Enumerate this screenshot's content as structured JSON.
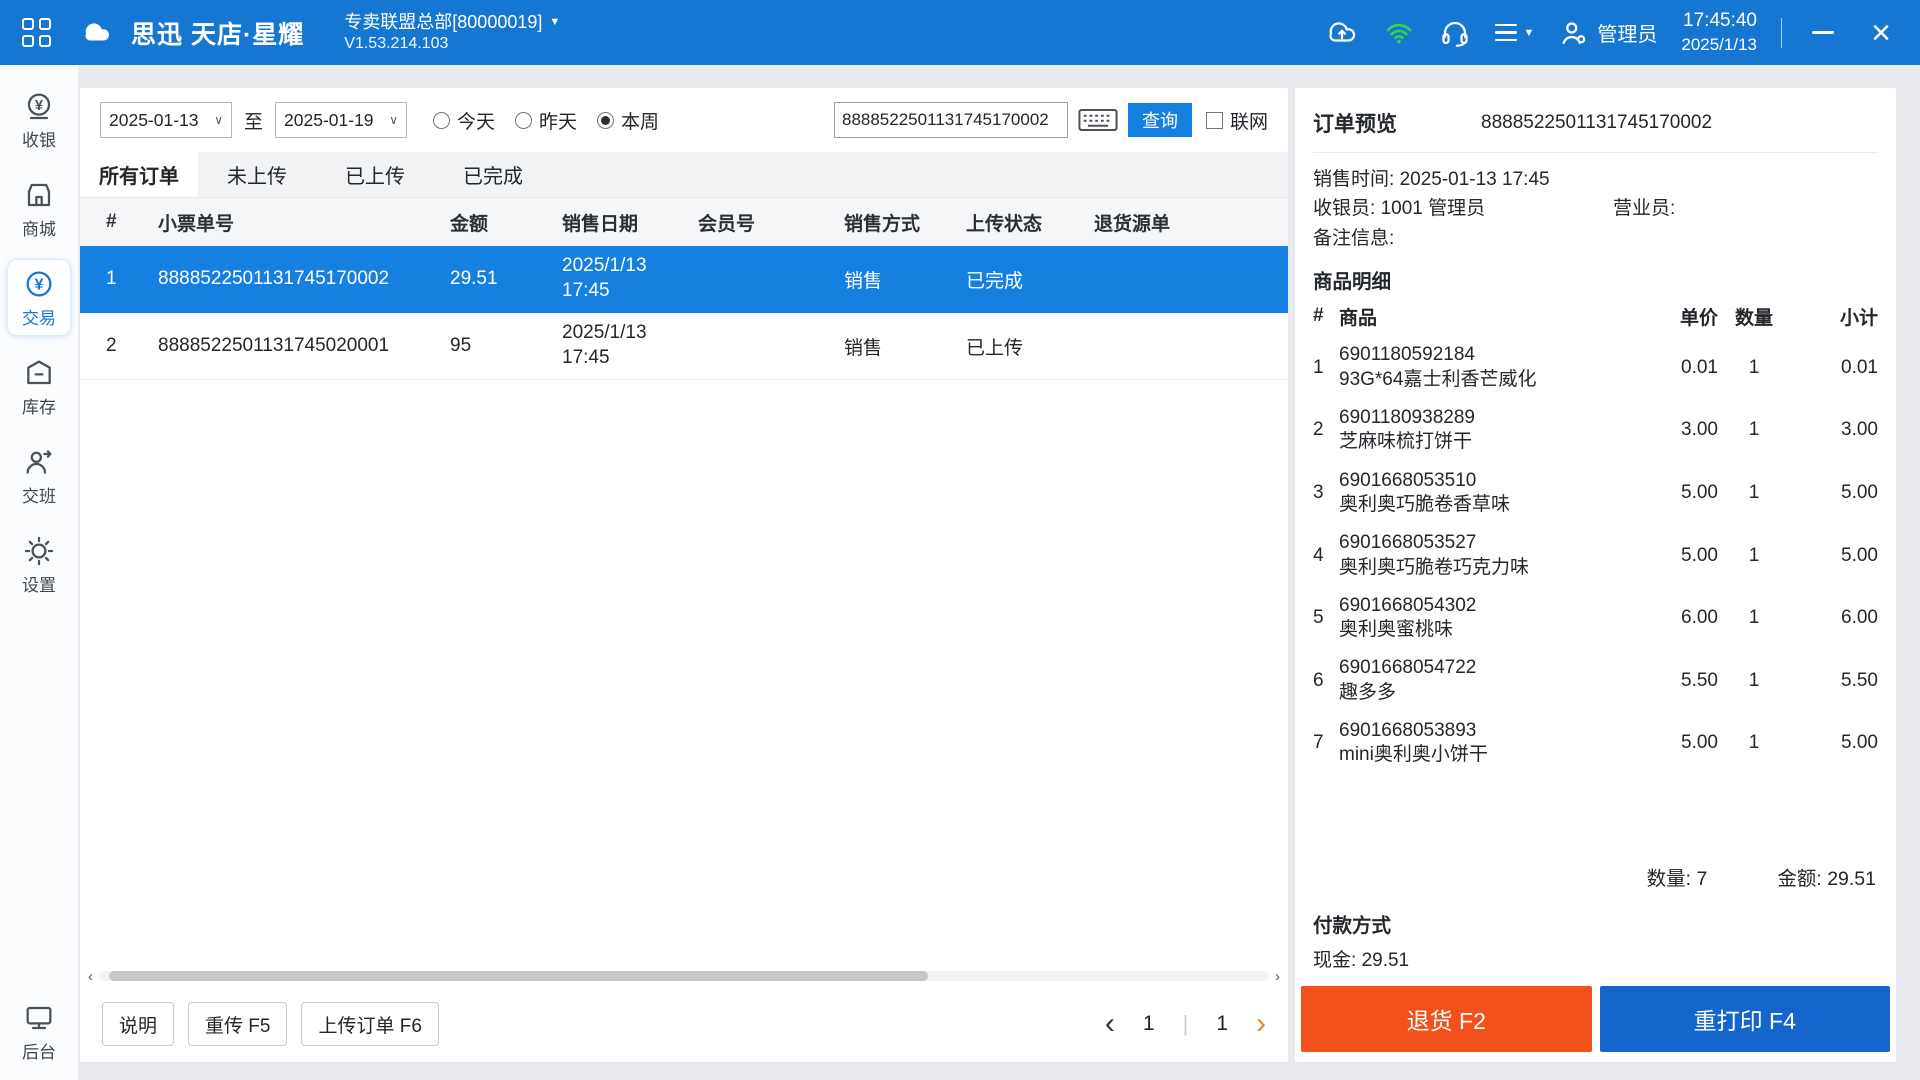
{
  "theme": {
    "topbar_blue": "#1577d2",
    "accent_blue": "#1680e0",
    "selected_row_blue": "#1680e0",
    "refund_orange": "#f3511c",
    "reprint_blue": "#1566cc",
    "wifi_green": "#35d14b",
    "next_arrow_orange": "#f08224"
  },
  "topbar": {
    "brand": "思迅 天店·星耀",
    "store": "专卖联盟总部[80000019]",
    "version": "V1.53.214.103",
    "user": "管理员",
    "time": "17:45:40",
    "date": "2025/1/13"
  },
  "sidebar": {
    "items": [
      {
        "label": "收银"
      },
      {
        "label": "商城"
      },
      {
        "label": "交易"
      },
      {
        "label": "库存"
      },
      {
        "label": "交班"
      },
      {
        "label": "设置"
      }
    ],
    "bottom": {
      "label": "后台"
    }
  },
  "filters": {
    "date_from": "2025-01-13",
    "range_separator": "至",
    "date_to": "2025-01-19",
    "radios": [
      {
        "label": "今天",
        "checked": false
      },
      {
        "label": "昨天",
        "checked": false
      },
      {
        "label": "本周",
        "checked": true
      }
    ],
    "search_value": "8888522501131745170002",
    "query_button": "查询",
    "online_checkbox": "联网"
  },
  "tabs": [
    {
      "label": "所有订单",
      "active": true
    },
    {
      "label": "未上传",
      "active": false
    },
    {
      "label": "已上传",
      "active": false
    },
    {
      "label": "已完成",
      "active": false
    }
  ],
  "orders": {
    "headers": [
      "#",
      "小票单号",
      "金额",
      "销售日期",
      "会员号",
      "销售方式",
      "上传状态",
      "退货源单"
    ],
    "rows": [
      {
        "num": "1",
        "receipt_no": "8888522501131745170002",
        "amount": "29.51",
        "sale_date": "2025/1/13 17:45",
        "member_no": "",
        "sale_type": "销售",
        "upload_status": "已完成",
        "return_source": "",
        "selected": true
      },
      {
        "num": "2",
        "receipt_no": "8888522501131745020001",
        "amount": "95",
        "sale_date": "2025/1/13 17:45",
        "member_no": "",
        "sale_type": "销售",
        "upload_status": "已上传",
        "return_source": "",
        "selected": false
      }
    ]
  },
  "footer": {
    "help_button": "说明",
    "reupload_button": "重传 F5",
    "upload_button": "上传订单 F6",
    "page_current": "1",
    "page_total": "1"
  },
  "preview": {
    "title": "订单预览",
    "order_no": "8888522501131745170002",
    "sale_time_label": "销售时间:",
    "sale_time": "2025-01-13 17:45",
    "cashier_label": "收银员:",
    "cashier": "1001 管理员",
    "clerk_label": "营业员:",
    "remark_label": "备注信息:",
    "detail_title": "商品明细",
    "item_headers": [
      "#",
      "商品",
      "单价",
      "数量",
      "小计"
    ],
    "items": [
      {
        "num": "1",
        "code": "6901180592184",
        "name": "93G*64嘉士利香芒威化",
        "price": "0.01",
        "qty": "1",
        "subtotal": "0.01"
      },
      {
        "num": "2",
        "code": "6901180938289",
        "name": "芝麻味梳打饼干",
        "price": "3.00",
        "qty": "1",
        "subtotal": "3.00"
      },
      {
        "num": "3",
        "code": "6901668053510",
        "name": "奥利奥巧脆卷香草味",
        "price": "5.00",
        "qty": "1",
        "subtotal": "5.00"
      },
      {
        "num": "4",
        "code": "6901668053527",
        "name": "奥利奥巧脆卷巧克力味",
        "price": "5.00",
        "qty": "1",
        "subtotal": "5.00"
      },
      {
        "num": "5",
        "code": "6901668054302",
        "name": "奥利奥蜜桃味",
        "price": "6.00",
        "qty": "1",
        "subtotal": "6.00"
      },
      {
        "num": "6",
        "code": "6901668054722",
        "name": "趣多多",
        "price": "5.50",
        "qty": "1",
        "subtotal": "5.50"
      },
      {
        "num": "7",
        "code": "6901668053893",
        "name": "mini奥利奥小饼干",
        "price": "5.00",
        "qty": "1",
        "subtotal": "5.00"
      }
    ],
    "totals": {
      "qty_label": "数量: ",
      "qty_value": "7",
      "amount_label": "金额: ",
      "amount_value": "29.51"
    },
    "payment_title": "付款方式",
    "payment_method_label": "现金: ",
    "payment_method_value": "29.51",
    "refund_button": "退货 F2",
    "reprint_button": "重打印 F4"
  }
}
